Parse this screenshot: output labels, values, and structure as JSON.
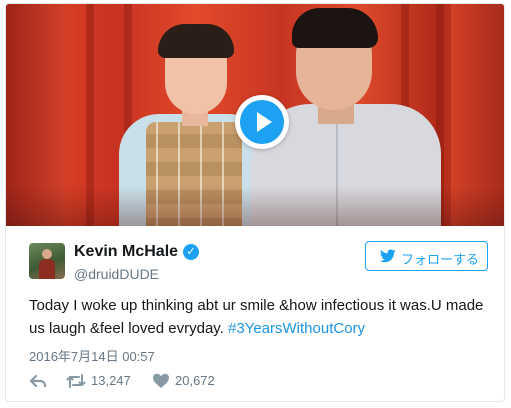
{
  "tweet": {
    "author_name": "Kevin McHale",
    "author_handle": "@druidDUDE",
    "verified": true,
    "follow_label": "フォローする",
    "text_main": "Today I woke up thinking abt ur smile &how infectious it was.U made us laugh &feel loved evryday. ",
    "hashtag": "#3YearsWithoutCory",
    "timestamp": "2016年7月14日 00:57",
    "retweets": "13,247",
    "likes": "20,672"
  },
  "media": {
    "type": "video",
    "play_icon": "play-icon"
  },
  "colors": {
    "accent": "#1da1f2",
    "link": "#1b95e0",
    "muted": "#657786",
    "border": "#e1e8ed"
  },
  "icons": {
    "reply": "reply-icon",
    "retweet": "retweet-icon",
    "like": "heart-icon",
    "verified": "verified-badge-icon",
    "follow": "twitter-bird-icon"
  }
}
